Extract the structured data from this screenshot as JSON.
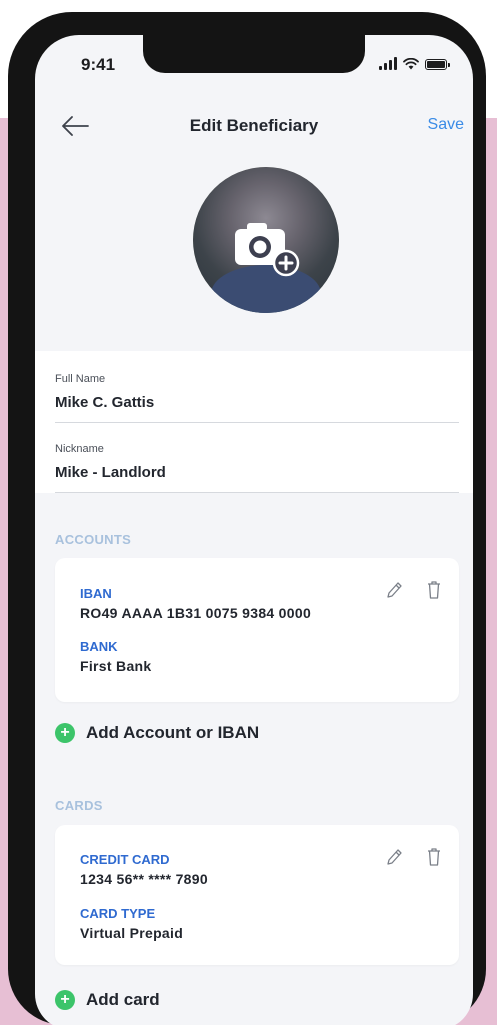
{
  "status": {
    "time": "9:41"
  },
  "header": {
    "title": "Edit Beneficiary",
    "save_label": "Save",
    "back_icon": "arrow-left-icon"
  },
  "avatar": {
    "icon": "camera-add-icon"
  },
  "form": {
    "full_name_label": "Full Name",
    "full_name_value": "Mike C. Gattis",
    "nickname_label": "Nickname",
    "nickname_value": "Mike - Landlord"
  },
  "accounts": {
    "section_title": "ACCOUNTS",
    "iban_label": "IBAN",
    "iban_value": "RO49 AAAA 1B31 0075 9384 0000",
    "bank_label": "BANK",
    "bank_value": "First Bank",
    "add_label": "Add Account or IBAN"
  },
  "cards": {
    "section_title": "CARDS",
    "credit_card_label": "CREDIT CARD",
    "credit_card_value": "1234 56** **** 7890",
    "card_type_label": "CARD TYPE",
    "card_type_value": "Virtual Prepaid",
    "add_label": "Add card"
  },
  "colors": {
    "accent_blue": "#3a8be6",
    "label_blue": "#2f6ad0",
    "section_header": "#a8c1dd",
    "add_green": "#3cc46a",
    "background_pink": "#e7bfd4"
  }
}
